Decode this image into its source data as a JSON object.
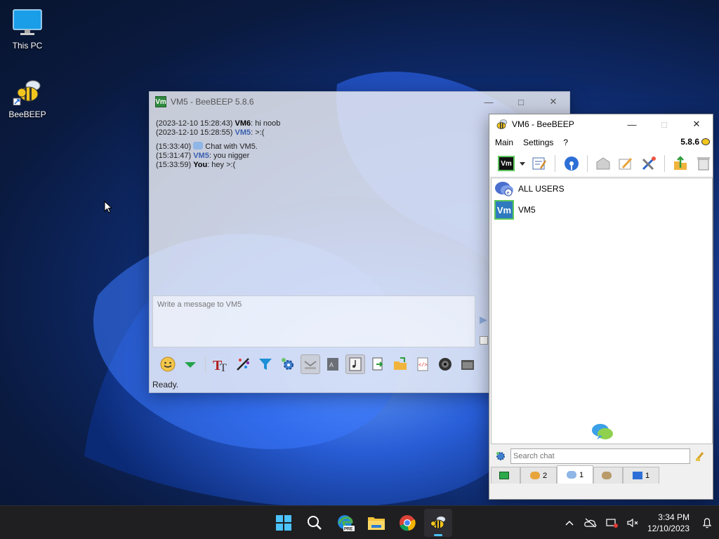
{
  "desktop": {
    "icons": [
      {
        "label": "This PC"
      },
      {
        "label": "BeeBEEP"
      }
    ]
  },
  "chat_window": {
    "title": "VM5 - BeeBEEP 5.8.6",
    "badge": "Vm",
    "log": [
      {
        "time": "(2023-12-10 15:28:43)",
        "user": "VM6",
        "text": ": hi noob"
      },
      {
        "time": "(2023-12-10 15:28:55)",
        "user": "VM5",
        "text": ": >:("
      },
      {
        "time": "(15:33:40)",
        "system": "Chat with VM5."
      },
      {
        "time": "(15:31:47)",
        "user": "VM5",
        "text": ": you nigger"
      },
      {
        "time": "(15:33:59)",
        "user": "You",
        "text": ": hey >:("
      }
    ],
    "input_placeholder": "Write a message to VM5",
    "status": "Ready."
  },
  "main_window": {
    "title": "VM6 - BeeBEEP",
    "menu": [
      "Main",
      "Settings",
      "?"
    ],
    "version": "5.8.6",
    "badge": "Vm",
    "users": [
      {
        "name": "ALL USERS"
      },
      {
        "name": "VM5",
        "badge": "Vm"
      }
    ],
    "search_placeholder": "Search chat",
    "tabs": [
      {
        "count": ""
      },
      {
        "count": "2"
      },
      {
        "count": "1"
      },
      {
        "count": ""
      },
      {
        "count": "1"
      }
    ]
  },
  "taskbar": {
    "time": "3:34 PM",
    "date": "12/10/2023",
    "edge_badge": "PRE"
  },
  "colors": {
    "taskbar_bg": "#1f1f22",
    "vm_badge_green": "#2f8a3e",
    "accent": "#4cc2ff"
  }
}
